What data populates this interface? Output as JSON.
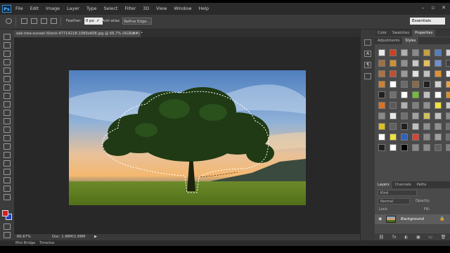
{
  "app": {
    "logo": "Ps"
  },
  "menu": [
    "File",
    "Edit",
    "Image",
    "Layer",
    "Type",
    "Select",
    "Filter",
    "3D",
    "View",
    "Window",
    "Help"
  ],
  "window_controls": {
    "minimize": "–",
    "restore": "▫",
    "close": "✕"
  },
  "options": {
    "feather_label": "Feather:",
    "feather_value": "0 px",
    "antialias_check": "✓",
    "antialias_label": "Anti-alias",
    "refine_edge": "Refine Edge...",
    "workspace": "Essentials"
  },
  "document": {
    "tab_title": "oak-tree-sunset-iStock-47714218-1080x608.jpg @ 66.7% (RGB/8#) *",
    "tab_close": "×"
  },
  "status": {
    "zoom": "66.67%",
    "doc_info": "Doc: 1.88M/1.88M",
    "arrow": "▶"
  },
  "bottom_tabs": [
    "Mini Bridge",
    "Timeline"
  ],
  "panel_strip_icons": [
    "A",
    "¶"
  ],
  "right_panel": {
    "top_tabs": [
      "Color",
      "Swatches",
      "Properties"
    ],
    "top_active": "Properties",
    "sub_tabs": [
      "Adjustments",
      "Styles"
    ],
    "sub_active": "Styles",
    "layers_tabs": [
      "Layers",
      "Channels",
      "Paths"
    ],
    "layers_active": "Layers",
    "kind_label": "Kind",
    "blend_mode": "Normal",
    "opacity_label": "Opacity:",
    "lock_label": "Lock:",
    "fill_label": "Fill:",
    "layer_eye": "◉",
    "layer_name": "Background",
    "layer_lock": "🔒",
    "bottom_icons": [
      "⛓",
      "fx",
      "◐",
      "▣",
      "▭",
      "🗑"
    ]
  },
  "style_swatches": [
    "#e8e8e8",
    "#d04020",
    "#b0b0b0",
    "#8a8a8a",
    "#c8a040",
    "#5080c0",
    "#d0d0d0",
    "#a07040",
    "#d09030",
    "#909090",
    "#c8c8c8",
    "#e0c060",
    "#7090d0",
    "#404040",
    "#b07040",
    "#c05030",
    "#9a9a9a",
    "#e0e0e0",
    "#c0c0c0",
    "#e09030",
    "#f0f0f0",
    "#d08030",
    "#ffffff",
    "#6a6a6a",
    "#8a6a40",
    "#202020",
    "#d0d0d0",
    "#f0a040",
    "#202020",
    "#707070",
    "#ffffff",
    "#70c030",
    "#c0c0c0",
    "#f8f8f8",
    "#e09020",
    "#e07020",
    "#5a5a5a",
    "#b0b0b0",
    "#808080",
    "#909090",
    "#f0e040",
    "#c8c8c8",
    "#8a8a8a",
    "#e8e8e8",
    "#707070",
    "#a0a0a0",
    "#d0c060",
    "#c0c0c0",
    "#8a8a8a",
    "#e0c020",
    "#606060",
    "#202020",
    "#c0c0c0",
    "#909090",
    "#909090",
    "#707070",
    "#ffffff",
    "#f0e040",
    "#3060c0",
    "#e04030",
    "#8a8a8a",
    "#a0a0a0",
    "#707070",
    "#202020",
    "#ffffff",
    "#000000",
    "#8a8a8a",
    "#8a8a8a",
    "#606060",
    "#808080"
  ]
}
